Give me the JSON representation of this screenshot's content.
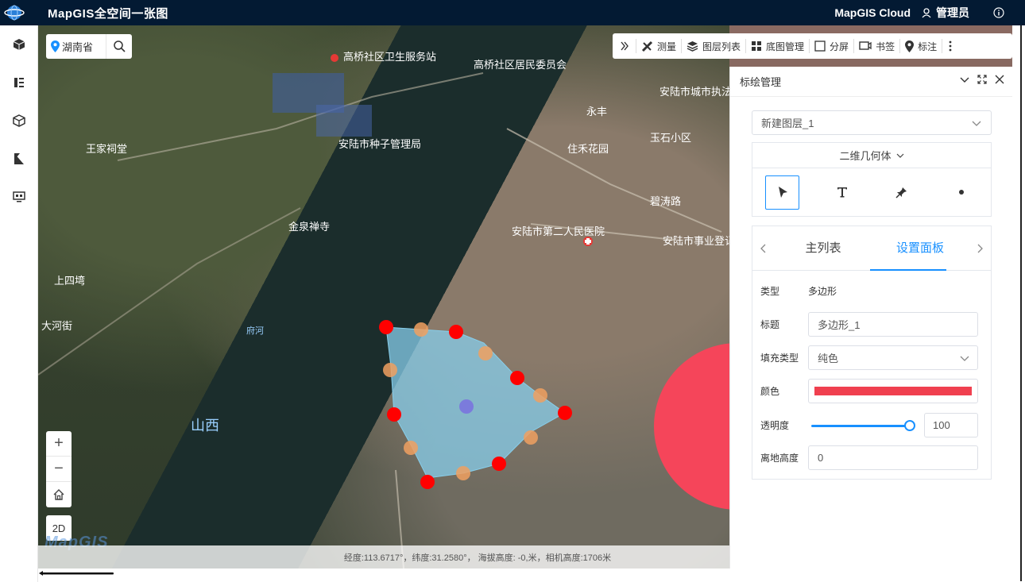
{
  "header": {
    "app_title": "MapGIS全空间一张图",
    "cloud_label": "MapGIS Cloud",
    "user_label": "管理员"
  },
  "search": {
    "location": "湖南省"
  },
  "toolbar": {
    "items": [
      {
        "label": "测量",
        "icon": "ruler-icon"
      },
      {
        "label": "图层列表",
        "icon": "layers-icon"
      },
      {
        "label": "底图管理",
        "icon": "grid-icon"
      },
      {
        "label": "分屏",
        "icon": "split-icon"
      },
      {
        "label": "书签",
        "icon": "bookmark-icon"
      },
      {
        "label": "标注",
        "icon": "pin-icon"
      }
    ]
  },
  "map": {
    "place_labels": [
      {
        "text": "高桥社区卫生服务站"
      },
      {
        "text": "高桥社区居民委员会"
      },
      {
        "text": "安陆市种子管理局"
      },
      {
        "text": "王家祠堂"
      },
      {
        "text": "金泉禅寺"
      },
      {
        "text": "上四塆"
      },
      {
        "text": "安陆市第二人民医院"
      },
      {
        "text": "安陆市事业登记管理局"
      },
      {
        "text": "安陆市城市执法大队"
      },
      {
        "text": "住禾花园"
      },
      {
        "text": "玉石小区"
      },
      {
        "text": "永丰"
      },
      {
        "text": "碧涛路"
      },
      {
        "text": "大河街"
      },
      {
        "text": "府河"
      },
      {
        "text": "山西"
      }
    ],
    "polygon_fill": "#87ceeb",
    "vertex_color": "#ff0000",
    "midpoint_color": "#f0a060",
    "center_color": "#7b7bdc",
    "circle_color": "#f5455a",
    "watermark": "MapGIS"
  },
  "controls": {
    "zoom_in": "+",
    "zoom_out": "−",
    "mode_2d": "2D"
  },
  "status": {
    "text": "经度:113.6717°，纬度:31.2580°， 海拔高度: -0,米，相机高度:1706米"
  },
  "panel": {
    "title": "标绘管理",
    "layer_select": "新建图层_1",
    "geometry_type": "二维几何体",
    "tabs": [
      "主列表",
      "设置面板"
    ],
    "active_tab": "设置面板",
    "fields": {
      "type_label": "类型",
      "type_value": "多边形",
      "title_label": "标题",
      "title_value": "多边形_1",
      "fill_label": "填充类型",
      "fill_value": "纯色",
      "color_label": "颜色",
      "color_value": "#f0404f",
      "opacity_label": "透明度",
      "opacity_value": "100",
      "height_label": "离地高度",
      "height_value": "0"
    }
  }
}
